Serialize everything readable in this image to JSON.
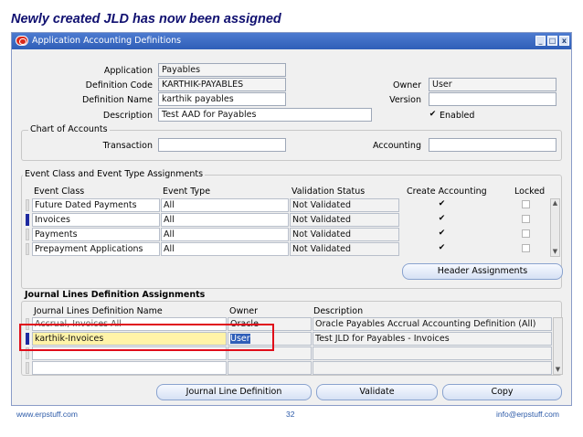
{
  "slide_title": "Newly created JLD has now been assigned",
  "window": {
    "title": "Application Accounting Definitions",
    "controls": [
      "_",
      "□",
      "x"
    ]
  },
  "header": {
    "application_label": "Application",
    "application_value": "Payables",
    "definition_code_label": "Definition Code",
    "definition_code_value": "KARTHIK-PAYABLES",
    "definition_name_label": "Definition Name",
    "definition_name_value": "karthik payables",
    "description_label": "Description",
    "description_value": "Test AAD for Payables",
    "owner_label": "Owner",
    "owner_value": "User",
    "version_label": "Version",
    "version_value": "",
    "enabled_label": "Enabled",
    "enabled_checked": true
  },
  "chart_of_accounts": {
    "title": "Chart of Accounts",
    "transaction_label": "Transaction",
    "transaction_value": "",
    "accounting_label": "Accounting",
    "accounting_value": ""
  },
  "event_assignments": {
    "title": "Event Class and Event Type Assignments",
    "columns": [
      "Event Class",
      "Event Type",
      "Validation Status",
      "Create Accounting",
      "Locked"
    ],
    "rows": [
      {
        "event_class": "Future Dated Payments",
        "event_type": "All",
        "status": "Not Validated",
        "create_accounting": true,
        "locked": false,
        "current": false
      },
      {
        "event_class": "Invoices",
        "event_type": "All",
        "status": "Not Validated",
        "create_accounting": true,
        "locked": false,
        "current": true
      },
      {
        "event_class": "Payments",
        "event_type": "All",
        "status": "Not Validated",
        "create_accounting": true,
        "locked": false,
        "current": false
      },
      {
        "event_class": "Prepayment Applications",
        "event_type": "All",
        "status": "Not Validated",
        "create_accounting": true,
        "locked": false,
        "current": false
      }
    ],
    "header_assignments_button": "Header Assignments"
  },
  "jld_assignments": {
    "title": "Journal Lines Definition Assignments",
    "columns": [
      "Journal Lines Definition Name",
      "Owner",
      "Description"
    ],
    "rows": [
      {
        "name": "Accrual, Invoices All",
        "owner": "Oracle",
        "description": "Oracle Payables Accrual Accounting Definition (All)",
        "current": false
      },
      {
        "name": "karthik-Invoices",
        "owner": "User",
        "description": "Test JLD for Payables - Invoices",
        "current": true
      },
      {
        "name": "",
        "owner": "",
        "description": "",
        "current": false
      },
      {
        "name": "",
        "owner": "",
        "description": "",
        "current": false
      }
    ]
  },
  "buttons": {
    "journal_line_definition": "Journal Line Definition",
    "validate": "Validate",
    "copy": "Copy"
  },
  "footer": {
    "left": "www.erpstuff.com",
    "center": "32",
    "right": "info@erpstuff.com"
  },
  "colors": {
    "title_blue": "#101070",
    "titlebar": "#2f5eb8",
    "highlight_red": "#e00d1a",
    "selected_row": "#fff3a8"
  }
}
